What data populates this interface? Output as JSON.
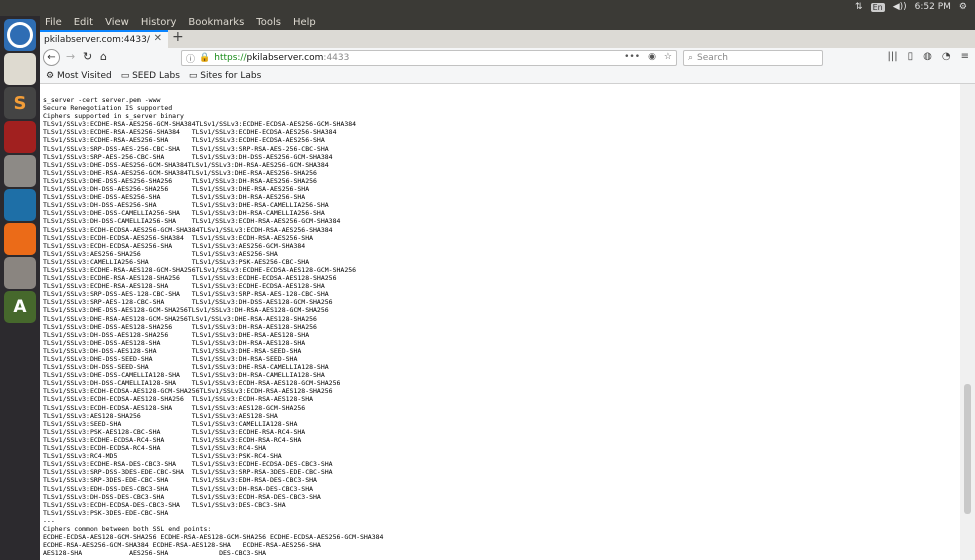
{
  "system": {
    "lang": "En",
    "volume": "◀))",
    "time": "6:52 PM"
  },
  "menu": [
    "File",
    "Edit",
    "View",
    "History",
    "Bookmarks",
    "Tools",
    "Help"
  ],
  "tab": {
    "title": "pkilabserver.com:4433/",
    "close": "✕"
  },
  "url": {
    "scheme": "https://",
    "host": "pkilabserver.com",
    "port": ":4433"
  },
  "search": {
    "placeholder": "Search"
  },
  "bookmarks": [
    "Most Visited",
    "SEED Labs",
    "Sites for Labs"
  ],
  "output": "s_server -cert server.pem -www\nSecure Renegotiation IS supported\nCiphers supported in s_server binary\nTLSv1/SSLv3:ECDHE-RSA-AES256-GCM-SHA384TLSv1/SSLv3:ECDHE-ECDSA-AES256-GCM-SHA384\nTLSv1/SSLv3:ECDHE-RSA-AES256-SHA384   TLSv1/SSLv3:ECDHE-ECDSA-AES256-SHA384\nTLSv1/SSLv3:ECDHE-RSA-AES256-SHA      TLSv1/SSLv3:ECDHE-ECDSA-AES256-SHA\nTLSv1/SSLv3:SRP-DSS-AES-256-CBC-SHA   TLSv1/SSLv3:SRP-RSA-AES-256-CBC-SHA\nTLSv1/SSLv3:SRP-AES-256-CBC-SHA       TLSv1/SSLv3:DH-DSS-AES256-GCM-SHA384\nTLSv1/SSLv3:DHE-DSS-AES256-GCM-SHA384TLSv1/SSLv3:DH-RSA-AES256-GCM-SHA384\nTLSv1/SSLv3:DHE-RSA-AES256-GCM-SHA384TLSv1/SSLv3:DHE-RSA-AES256-SHA256\nTLSv1/SSLv3:DHE-DSS-AES256-SHA256     TLSv1/SSLv3:DH-RSA-AES256-SHA256\nTLSv1/SSLv3:DH-DSS-AES256-SHA256      TLSv1/SSLv3:DHE-RSA-AES256-SHA\nTLSv1/SSLv3:DHE-DSS-AES256-SHA        TLSv1/SSLv3:DH-RSA-AES256-SHA\nTLSv1/SSLv3:DH-DSS-AES256-SHA         TLSv1/SSLv3:DHE-RSA-CAMELLIA256-SHA\nTLSv1/SSLv3:DHE-DSS-CAMELLIA256-SHA   TLSv1/SSLv3:DH-RSA-CAMELLIA256-SHA\nTLSv1/SSLv3:DH-DSS-CAMELLIA256-SHA    TLSv1/SSLv3:ECDH-RSA-AES256-GCM-SHA384\nTLSv1/SSLv3:ECDH-ECDSA-AES256-GCM-SHA384TLSv1/SSLv3:ECDH-RSA-AES256-SHA384\nTLSv1/SSLv3:ECDH-ECDSA-AES256-SHA384  TLSv1/SSLv3:ECDH-RSA-AES256-SHA\nTLSv1/SSLv3:ECDH-ECDSA-AES256-SHA     TLSv1/SSLv3:AES256-GCM-SHA384\nTLSv1/SSLv3:AES256-SHA256             TLSv1/SSLv3:AES256-SHA\nTLSv1/SSLv3:CAMELLIA256-SHA           TLSv1/SSLv3:PSK-AES256-CBC-SHA\nTLSv1/SSLv3:ECDHE-RSA-AES128-GCM-SHA256TLSv1/SSLv3:ECDHE-ECDSA-AES128-GCM-SHA256\nTLSv1/SSLv3:ECDHE-RSA-AES128-SHA256   TLSv1/SSLv3:ECDHE-ECDSA-AES128-SHA256\nTLSv1/SSLv3:ECDHE-RSA-AES128-SHA      TLSv1/SSLv3:ECDHE-ECDSA-AES128-SHA\nTLSv1/SSLv3:SRP-DSS-AES-128-CBC-SHA   TLSv1/SSLv3:SRP-RSA-AES-128-CBC-SHA\nTLSv1/SSLv3:SRP-AES-128-CBC-SHA       TLSv1/SSLv3:DH-DSS-AES128-GCM-SHA256\nTLSv1/SSLv3:DHE-DSS-AES128-GCM-SHA256TLSv1/SSLv3:DH-RSA-AES128-GCM-SHA256\nTLSv1/SSLv3:DHE-RSA-AES128-GCM-SHA256TLSv1/SSLv3:DHE-RSA-AES128-SHA256\nTLSv1/SSLv3:DHE-DSS-AES128-SHA256     TLSv1/SSLv3:DH-RSA-AES128-SHA256\nTLSv1/SSLv3:DH-DSS-AES128-SHA256      TLSv1/SSLv3:DHE-RSA-AES128-SHA\nTLSv1/SSLv3:DHE-DSS-AES128-SHA        TLSv1/SSLv3:DH-RSA-AES128-SHA\nTLSv1/SSLv3:DH-DSS-AES128-SHA         TLSv1/SSLv3:DHE-RSA-SEED-SHA\nTLSv1/SSLv3:DHE-DSS-SEED-SHA          TLSv1/SSLv3:DH-RSA-SEED-SHA\nTLSv1/SSLv3:DH-DSS-SEED-SHA           TLSv1/SSLv3:DHE-RSA-CAMELLIA128-SHA\nTLSv1/SSLv3:DHE-DSS-CAMELLIA128-SHA   TLSv1/SSLv3:DH-RSA-CAMELLIA128-SHA\nTLSv1/SSLv3:DH-DSS-CAMELLIA128-SHA    TLSv1/SSLv3:ECDH-RSA-AES128-GCM-SHA256\nTLSv1/SSLv3:ECDH-ECDSA-AES128-GCM-SHA256TLSv1/SSLv3:ECDH-RSA-AES128-SHA256\nTLSv1/SSLv3:ECDH-ECDSA-AES128-SHA256  TLSv1/SSLv3:ECDH-RSA-AES128-SHA\nTLSv1/SSLv3:ECDH-ECDSA-AES128-SHA     TLSv1/SSLv3:AES128-GCM-SHA256\nTLSv1/SSLv3:AES128-SHA256             TLSv1/SSLv3:AES128-SHA\nTLSv1/SSLv3:SEED-SHA                  TLSv1/SSLv3:CAMELLIA128-SHA\nTLSv1/SSLv3:PSK-AES128-CBC-SHA        TLSv1/SSLv3:ECDHE-RSA-RC4-SHA\nTLSv1/SSLv3:ECDHE-ECDSA-RC4-SHA       TLSv1/SSLv3:ECDH-RSA-RC4-SHA\nTLSv1/SSLv3:ECDH-ECDSA-RC4-SHA        TLSv1/SSLv3:RC4-SHA\nTLSv1/SSLv3:RC4-MD5                   TLSv1/SSLv3:PSK-RC4-SHA\nTLSv1/SSLv3:ECDHE-RSA-DES-CBC3-SHA    TLSv1/SSLv3:ECDHE-ECDSA-DES-CBC3-SHA\nTLSv1/SSLv3:SRP-DSS-3DES-EDE-CBC-SHA  TLSv1/SSLv3:SRP-RSA-3DES-EDE-CBC-SHA\nTLSv1/SSLv3:SRP-3DES-EDE-CBC-SHA      TLSv1/SSLv3:EDH-RSA-DES-CBC3-SHA\nTLSv1/SSLv3:EDH-DSS-DES-CBC3-SHA      TLSv1/SSLv3:DH-RSA-DES-CBC3-SHA\nTLSv1/SSLv3:DH-DSS-DES-CBC3-SHA       TLSv1/SSLv3:ECDH-RSA-DES-CBC3-SHA\nTLSv1/SSLv3:ECDH-ECDSA-DES-CBC3-SHA   TLSv1/SSLv3:DES-CBC3-SHA\nTLSv1/SSLv3:PSK-3DES-EDE-CBC-SHA\n---\nCiphers common between both SSL end points:\nECDHE-ECDSA-AES128-GCM-SHA256 ECDHE-RSA-AES128-GCM-SHA256 ECDHE-ECDSA-AES256-GCM-SHA384\nECDHE-RSA-AES256-GCM-SHA384 ECDHE-RSA-AES128-SHA   ECDHE-RSA-AES256-SHA\nAES128-SHA            AES256-SHA             DES-CBC3-SHA"
}
